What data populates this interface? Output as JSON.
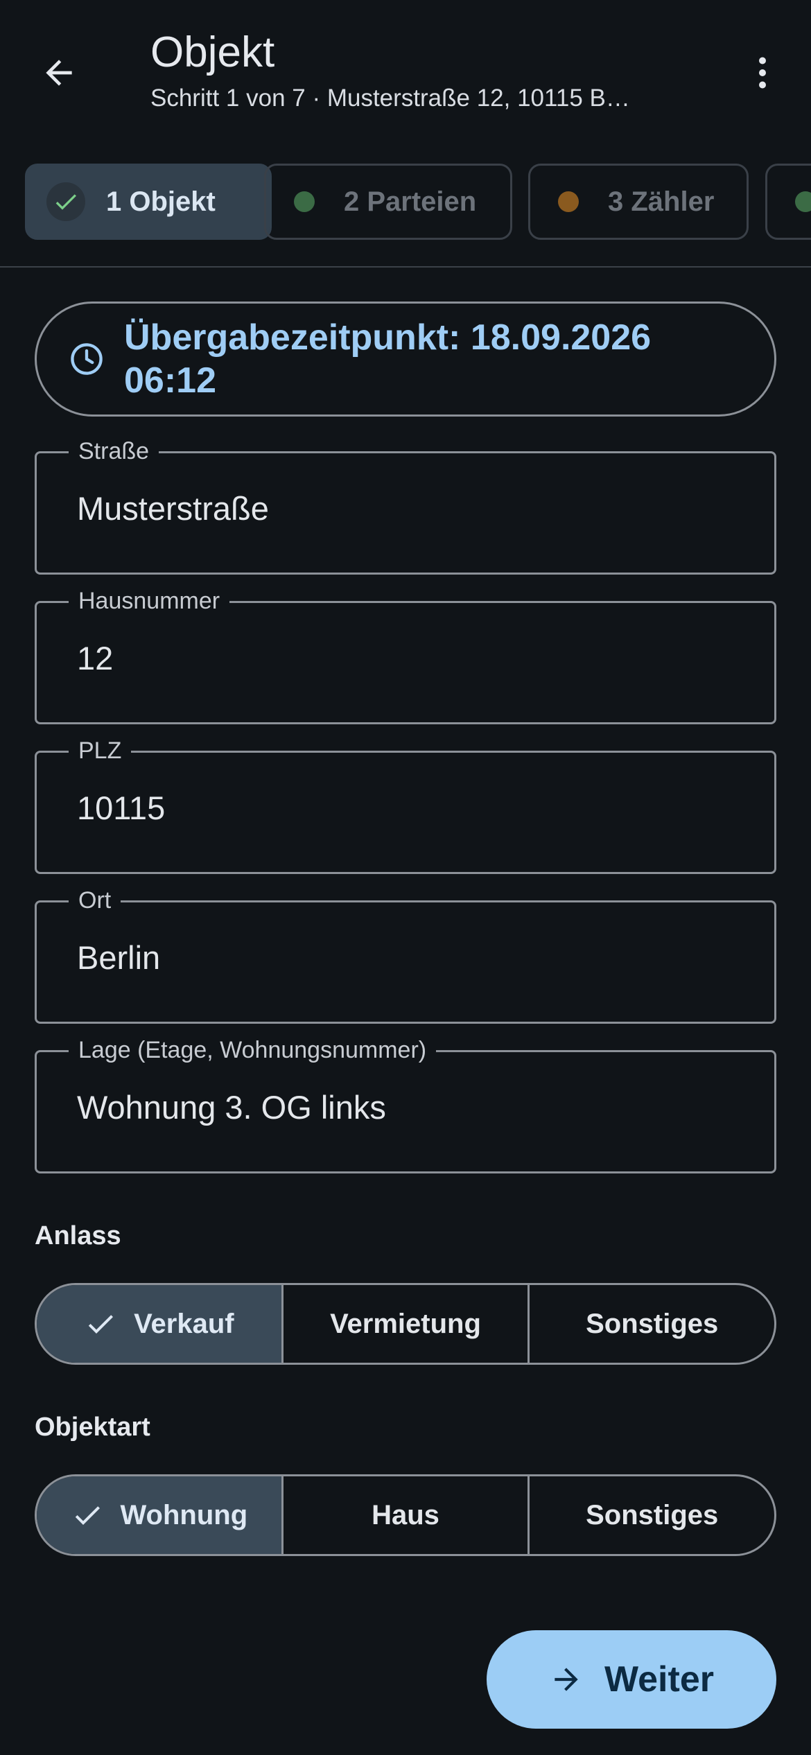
{
  "appbar": {
    "title": "Objekt",
    "subtitle": "Schritt 1 von 7 · Musterstraße 12, 10115 B…",
    "back_icon": "arrow-back-icon",
    "more_icon": "more-vert-icon"
  },
  "steps": [
    {
      "label": "1 Objekt",
      "status": "done",
      "color": "#7ccf8a",
      "selected": true
    },
    {
      "label": "2 Parteien",
      "status": "ok",
      "color": "#3b6b45",
      "selected": false
    },
    {
      "label": "3 Zähler",
      "status": "warning",
      "color": "#8a5a1f",
      "selected": false
    },
    {
      "label": "",
      "status": "ok",
      "color": "#3b6b45",
      "selected": false
    }
  ],
  "handover": {
    "icon": "clock-icon",
    "text": "Übergabezeitpunkt: 18.09.2026 06:12"
  },
  "fields": [
    {
      "label": "Straße",
      "value": "Musterstraße"
    },
    {
      "label": "Hausnummer",
      "value": "12"
    },
    {
      "label": "PLZ",
      "value": "10115"
    },
    {
      "label": "Ort",
      "value": "Berlin"
    },
    {
      "label": "Lage (Etage, Wohnungsnummer)",
      "value": "Wohnung 3. OG links"
    }
  ],
  "anlass": {
    "label": "Anlass",
    "options": [
      "Verkauf",
      "Vermietung",
      "Sonstiges"
    ],
    "selected": "Verkauf"
  },
  "objektart": {
    "label": "Objektart",
    "options": [
      "Wohnung",
      "Haus",
      "Sonstiges"
    ],
    "selected": "Wohnung"
  },
  "next_button": {
    "label": "Weiter",
    "icon": "arrow-forward-icon"
  },
  "colors": {
    "background": "#101418",
    "accent": "#9ccdf5",
    "selected_segment": "#3a4a58"
  }
}
